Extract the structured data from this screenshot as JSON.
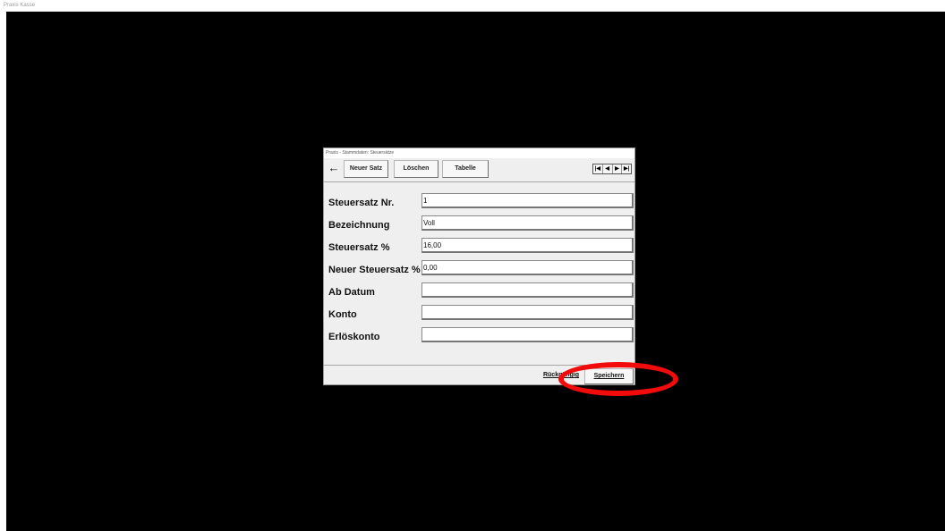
{
  "app": {
    "title": "Praxis Kasse"
  },
  "dialog": {
    "title": "Praxis - Stammdaten: Steuersätze",
    "toolbar": {
      "back_icon": "←",
      "new_label": "Neuer Satz",
      "delete_label": "Löschen",
      "table_label": "Tabelle",
      "nav": {
        "first": "|◀",
        "prev": "◀",
        "next": "▶",
        "last": "▶|"
      }
    },
    "fields": [
      {
        "label": "Steuersatz Nr.",
        "value": "1"
      },
      {
        "label": "Bezeichnung",
        "value": "Voll"
      },
      {
        "label": "Steuersatz %",
        "value": "16,00"
      },
      {
        "label": "Neuer Steuersatz %",
        "value": "0,00"
      },
      {
        "label": "Ab Datum",
        "value": ""
      },
      {
        "label": "Konto",
        "value": ""
      },
      {
        "label": "Erlöskonto",
        "value": ""
      }
    ],
    "footer": {
      "undo_label": "Rückgängig",
      "save_label": "Speichern"
    }
  },
  "annotation": {
    "highlight_color": "#f20b0b"
  }
}
